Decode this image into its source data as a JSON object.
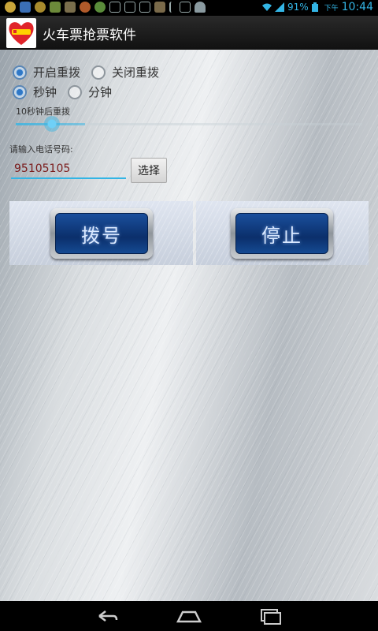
{
  "status_bar": {
    "battery": "91%",
    "ampm": "下午",
    "time": "10:44",
    "notification_icons": [
      "app-icon",
      "message-icon",
      "app-icon",
      "app-icon",
      "app-icon",
      "app-icon",
      "app-icon",
      "mail-icon",
      "mail-icon",
      "mail-icon",
      "image-icon",
      "usb-icon",
      "mail-icon",
      "android-icon"
    ]
  },
  "title_bar": {
    "title": "火车票抢票软件"
  },
  "redial": {
    "options": [
      {
        "label": "开启重拨",
        "checked": true
      },
      {
        "label": "关闭重拨",
        "checked": false
      }
    ]
  },
  "unit": {
    "options": [
      {
        "label": "秒钟",
        "checked": true
      },
      {
        "label": "分钟",
        "checked": false
      }
    ]
  },
  "slider": {
    "label": "10秒钟后重拨"
  },
  "phone": {
    "label": "请输入电话号码:",
    "value": "95105105"
  },
  "select_button": "选择",
  "actions": {
    "dial": "拨号",
    "stop": "停止"
  },
  "colors": {
    "accent": "#33b5e5",
    "button_face": "#0b2f6b"
  }
}
